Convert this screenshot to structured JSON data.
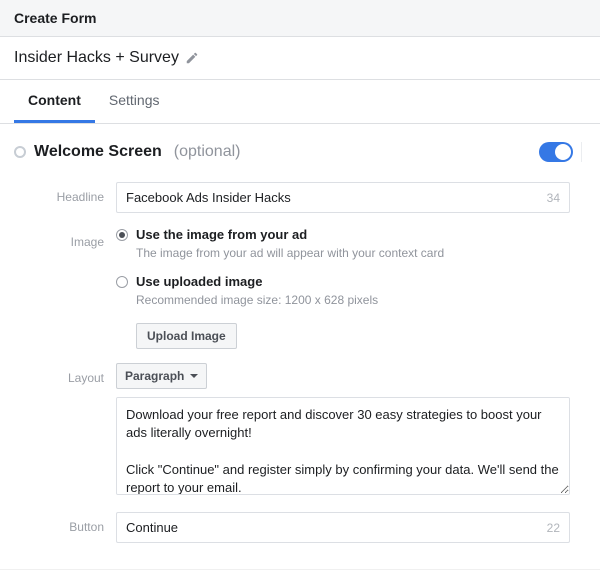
{
  "header": {
    "title": "Create Form"
  },
  "form_name": "Insider Hacks + Survey",
  "tabs": {
    "content": "Content",
    "settings": "Settings"
  },
  "welcome": {
    "title": "Welcome Screen",
    "optional_label": "(optional)",
    "labels": {
      "headline": "Headline",
      "image": "Image",
      "layout": "Layout",
      "button": "Button"
    },
    "headline": {
      "value": "Facebook Ads Insider Hacks",
      "count": "34"
    },
    "image": {
      "from_ad_label": "Use the image from your ad",
      "from_ad_sub": "The image from your ad will appear with your context card",
      "uploaded_label": "Use uploaded image",
      "uploaded_sub": "Recommended image size: 1200 x 628 pixels",
      "upload_btn": "Upload Image"
    },
    "layout": {
      "dropdown_value": "Paragraph",
      "text": "Download your free report and discover 30 easy strategies to boost your ads literally overnight!\n\nClick \"Continue\" and register simply by confirming your data. We'll send the report to your email."
    },
    "button": {
      "value": "Continue",
      "count": "22"
    }
  }
}
